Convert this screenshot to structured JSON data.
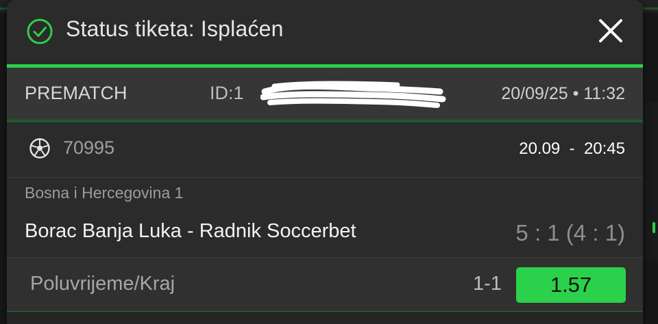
{
  "header": {
    "title": "Status tiketa: Isplaćen",
    "status_icon": "check-circle-icon",
    "close_icon": "close-icon"
  },
  "ticket": {
    "type": "PREMATCH",
    "id_label": "ID:1",
    "timestamp": "20/09/25 • 11:32"
  },
  "match": {
    "sport_icon": "soccer-ball-icon",
    "code": "70995",
    "datetime": "20.09  -  20:45",
    "league": "Bosna i Hercegovina 1",
    "teams": "Borac Banja Luka - Radnik Soccerbet",
    "score": "5 : 1 (4 : 1)"
  },
  "bet": {
    "market": "Poluvrijeme/Kraj",
    "pick": "1-1",
    "odds": "1.57"
  },
  "colors": {
    "accent": "#2bd14a",
    "background": "#2b2b2b",
    "row_background": "#363636"
  }
}
